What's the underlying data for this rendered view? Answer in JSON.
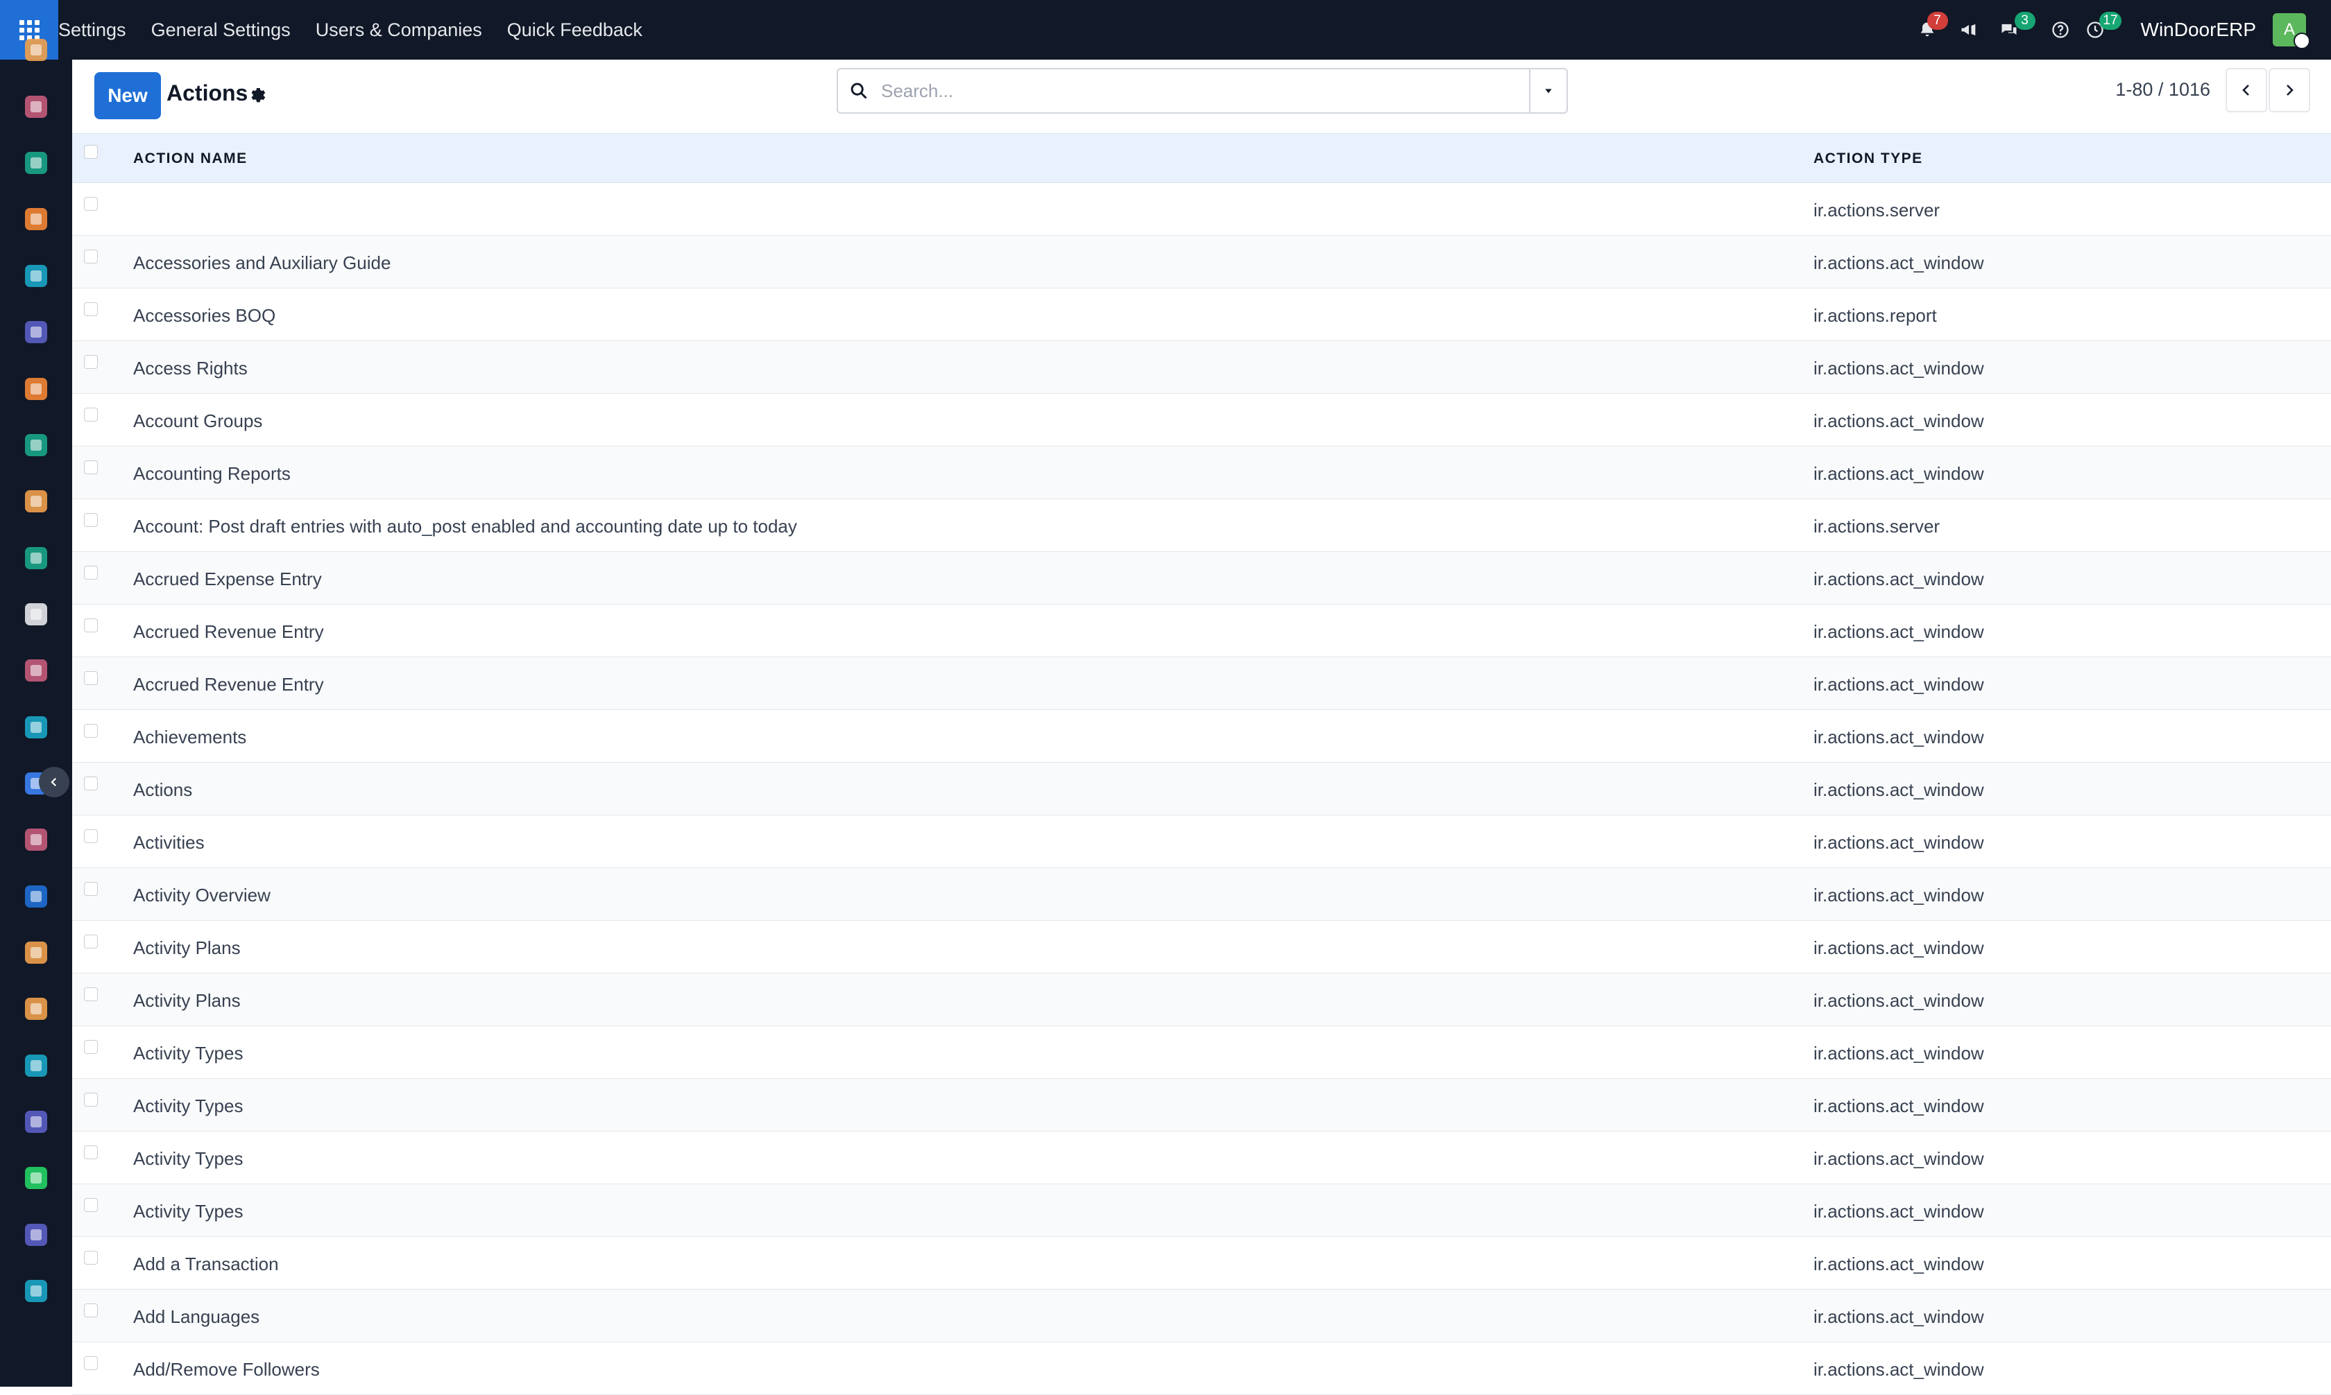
{
  "topbar": {
    "menu": [
      "Settings",
      "General Settings",
      "Users & Companies",
      "Quick Feedback"
    ],
    "badges": {
      "notifications": "7",
      "messages": "3",
      "activities": "17"
    },
    "company": "WinDoorERP",
    "avatar_letter": "A"
  },
  "control": {
    "new_label": "New",
    "title": "Actions",
    "search_placeholder": "Search...",
    "pager": "1-80 / 1016"
  },
  "columns": {
    "name": "ACTION NAME",
    "type": "ACTION TYPE"
  },
  "rows": [
    {
      "name": "",
      "type": "ir.actions.server"
    },
    {
      "name": "Accessories and Auxiliary Guide",
      "type": "ir.actions.act_window"
    },
    {
      "name": "Accessories BOQ",
      "type": "ir.actions.report"
    },
    {
      "name": "Access Rights",
      "type": "ir.actions.act_window"
    },
    {
      "name": "Account Groups",
      "type": "ir.actions.act_window"
    },
    {
      "name": "Accounting Reports",
      "type": "ir.actions.act_window"
    },
    {
      "name": "Account: Post draft entries with auto_post enabled and accounting date up to today",
      "type": "ir.actions.server"
    },
    {
      "name": "Accrued Expense Entry",
      "type": "ir.actions.act_window"
    },
    {
      "name": "Accrued Revenue Entry",
      "type": "ir.actions.act_window"
    },
    {
      "name": "Accrued Revenue Entry",
      "type": "ir.actions.act_window"
    },
    {
      "name": "Achievements",
      "type": "ir.actions.act_window"
    },
    {
      "name": "Actions",
      "type": "ir.actions.act_window"
    },
    {
      "name": "Activities",
      "type": "ir.actions.act_window"
    },
    {
      "name": "Activity Overview",
      "type": "ir.actions.act_window"
    },
    {
      "name": "Activity Plans",
      "type": "ir.actions.act_window"
    },
    {
      "name": "Activity Plans",
      "type": "ir.actions.act_window"
    },
    {
      "name": "Activity Types",
      "type": "ir.actions.act_window"
    },
    {
      "name": "Activity Types",
      "type": "ir.actions.act_window"
    },
    {
      "name": "Activity Types",
      "type": "ir.actions.act_window"
    },
    {
      "name": "Activity Types",
      "type": "ir.actions.act_window"
    },
    {
      "name": "Add a Transaction",
      "type": "ir.actions.act_window"
    },
    {
      "name": "Add Languages",
      "type": "ir.actions.act_window"
    },
    {
      "name": "Add/Remove Followers",
      "type": "ir.actions.act_window"
    }
  ],
  "sidebar_apps": [
    {
      "icon": "reporting-icon",
      "color": "#f0a04b"
    },
    {
      "icon": "apps-store-icon",
      "color": "#c65b7c"
    },
    {
      "icon": "contacts-icon",
      "color": "#1aa68a"
    },
    {
      "icon": "discuss-icon",
      "color": "#f58634"
    },
    {
      "icon": "sign-icon",
      "color": "#1aa6c7"
    },
    {
      "icon": "email-marketing-icon",
      "color": "#5b5fc7"
    },
    {
      "icon": "chat-icon",
      "color": "#f58634"
    },
    {
      "icon": "project-icon",
      "color": "#1aa68a"
    },
    {
      "icon": "dashboard-icon",
      "color": "#f0a04b"
    },
    {
      "icon": "employees-icon",
      "color": "#1aa68a"
    },
    {
      "icon": "inventory-icon",
      "color": "#e5e7eb"
    },
    {
      "icon": "apps-icon",
      "color": "#c65b7c"
    },
    {
      "icon": "todo-icon",
      "color": "#1aa6c7"
    },
    {
      "icon": "knowledge-icon",
      "color": "#3b82f6"
    },
    {
      "icon": "modules-icon",
      "color": "#c65b7c"
    },
    {
      "icon": "invoicing-icon",
      "color": "#1f6fd6"
    },
    {
      "icon": "team-icon",
      "color": "#f0a04b"
    },
    {
      "icon": "calendar-icon",
      "color": "#f0a04b"
    },
    {
      "icon": "sign-pen-icon",
      "color": "#1aa6c7"
    },
    {
      "icon": "layout-icon",
      "color": "#5b5fc7"
    },
    {
      "icon": "whatsapp-icon",
      "color": "#25d366"
    },
    {
      "icon": "timesheet-icon",
      "color": "#5b5fc7"
    },
    {
      "icon": "sync-icon",
      "color": "#1aa6c7"
    }
  ]
}
